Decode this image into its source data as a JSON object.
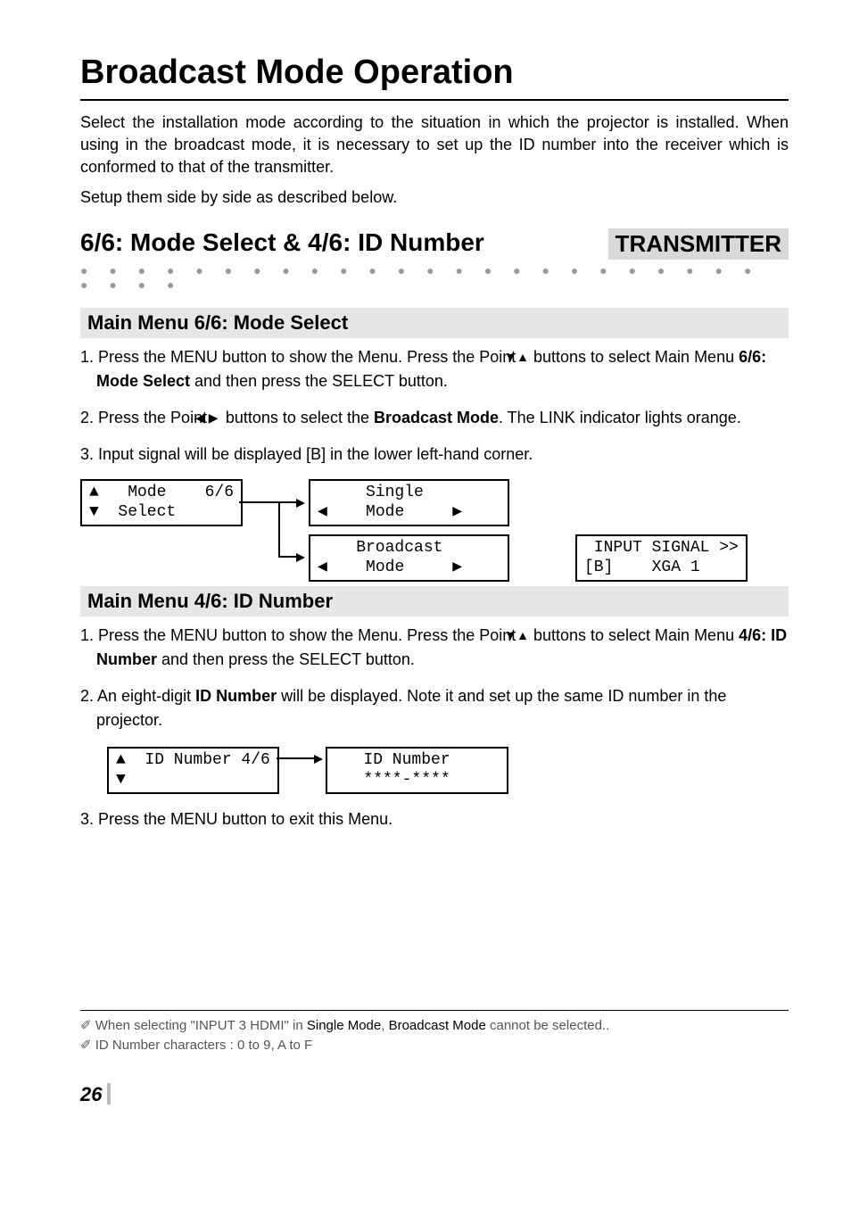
{
  "title": "Broadcast Mode Operation",
  "intro_p1": "Select the installation mode according to the situation in which the projector is installed. When using in the broadcast mode, it is necessary to set up the ID number into the receiver which is conformed to that of the transmitter.",
  "intro_p2": "Setup them side by side as described below.",
  "section_heading": "6/6: Mode Select & 4/6: ID Number",
  "badge": "TRANSMITTER",
  "sub1": {
    "heading": "Main Menu 6/6: Mode Select",
    "step1_a": "1. Press the MENU button to show the Menu. Press the Point ",
    "step1_b": " buttons to select Main Menu ",
    "step1_bold": "6/6: Mode Select",
    "step1_c": " and then press the SELECT button.",
    "step2_a": "2. Press the Point ",
    "step2_b": " buttons to select the ",
    "step2_bold": "Broadcast Mode",
    "step2_c": ". The LINK indicator lights orange.",
    "step3": "3. Input signal will be displayed [B] in the lower left-hand corner.",
    "lcd_menu": "▲   Mode    6/6\n▼  Select      ",
    "lcd_single": "     Single    \n◀    Mode     ▶",
    "lcd_broadcast": "    Broadcast  \n◀    Mode     ▶",
    "lcd_signal": " INPUT SIGNAL >>\n[B]    XGA 1    "
  },
  "sub2": {
    "heading": "Main Menu 4/6: ID Number",
    "step1_a": "1. Press the MENU button to show the Menu. Press the Point ",
    "step1_b": " buttons to select Main Menu ",
    "step1_bold": "4/6: ID Number",
    "step1_c": " and then press the SELECT button.",
    "step2_a": "2. An eight-digit ",
    "step2_bold": "ID Number",
    "step2_b": " will be displayed. Note it and set up the same ID number in the projector.",
    "lcd_menu": "▲  ID Number 4/6\n▼               ",
    "lcd_id": "   ID Number   \n   ****-****   ",
    "step3": "3. Press the MENU button to exit this Menu."
  },
  "footnotes": {
    "f1_a": "✐ When selecting \"INPUT 3 HDMI\" in ",
    "f1_b": "Single Mode",
    "f1_c": ", ",
    "f1_d": "Broadcast Mode",
    "f1_e": " cannot be selected..",
    "f2": "✐ ID Number characters : 0 to 9, A to F"
  },
  "page_number": "26"
}
